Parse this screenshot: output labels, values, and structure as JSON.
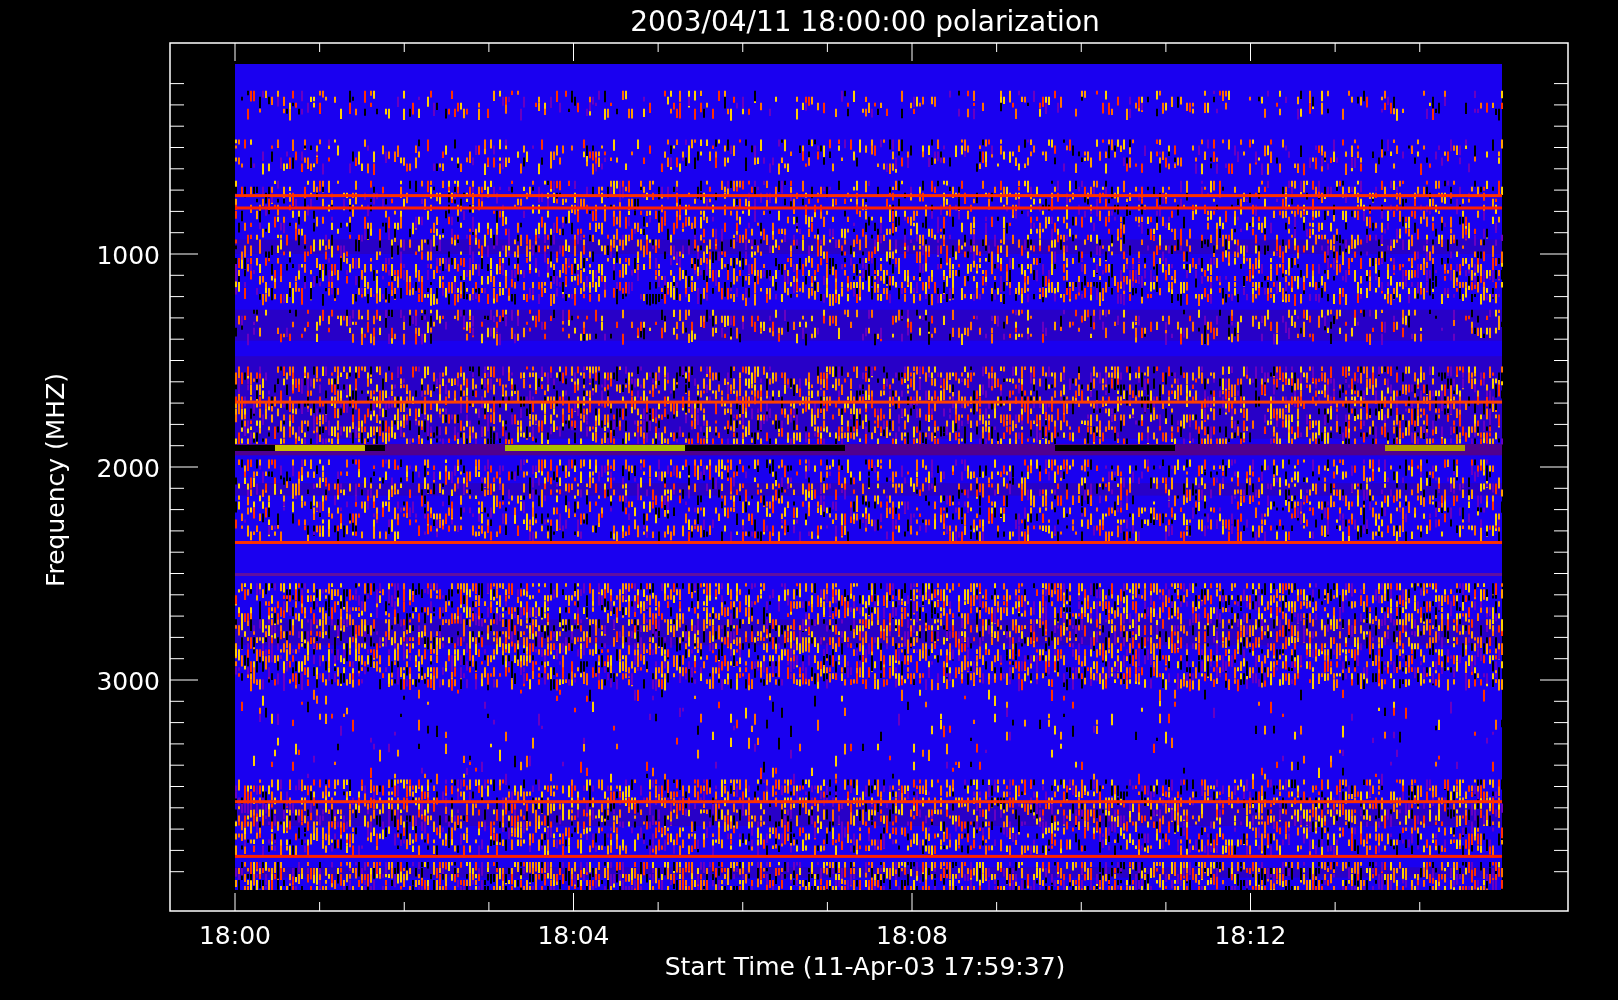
{
  "title": "2003/04/11 18:00:00 polarization",
  "y_axis": {
    "label": "Frequency (MHZ)",
    "ticks": [
      "1000",
      "2000",
      "3000"
    ]
  },
  "x_axis": {
    "label": "Start Time (11-Apr-03 17:59:37)",
    "ticks": [
      "18:00",
      "18:04",
      "18:08",
      "18:12"
    ]
  }
}
